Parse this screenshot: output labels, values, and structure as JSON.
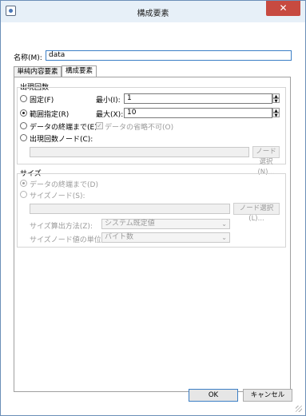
{
  "window": {
    "title": "構成要素",
    "close_glyph": "✕"
  },
  "name_field": {
    "label": "名称(M):",
    "value": "data"
  },
  "tabs": [
    {
      "label": "単純内容要素"
    },
    {
      "label": "構成要素"
    }
  ],
  "occurrence": {
    "group_label": "出現回数",
    "fixed_label": "固定(F)",
    "range_label": "範囲指定(R)",
    "until_end_label": "データの終端まで(E)",
    "node_label": "出現回数ノード(C):",
    "selected": "range",
    "min_label": "最小(I):",
    "min_value": "1",
    "max_label": "最大(X):",
    "max_value": "10",
    "omit_label": "データの省略不可(O)",
    "omit_checked": true,
    "node_value": "",
    "node_select_button": "ノード選択(N)..."
  },
  "size": {
    "group_label": "サイズ",
    "until_end_label": "データの終端まで(D)",
    "size_node_label": "サイズノード(S):",
    "selected": "until_end",
    "node_value": "",
    "node_select_button": "ノード選択(L)...",
    "calc_method_label": "サイズ算出方法(Z):",
    "calc_method_value": "システム既定値",
    "unit_label": "サイズノード値の単位(U):",
    "unit_value": "バイト数"
  },
  "footer": {
    "ok_label": "OK",
    "cancel_label": "キャンセル"
  }
}
